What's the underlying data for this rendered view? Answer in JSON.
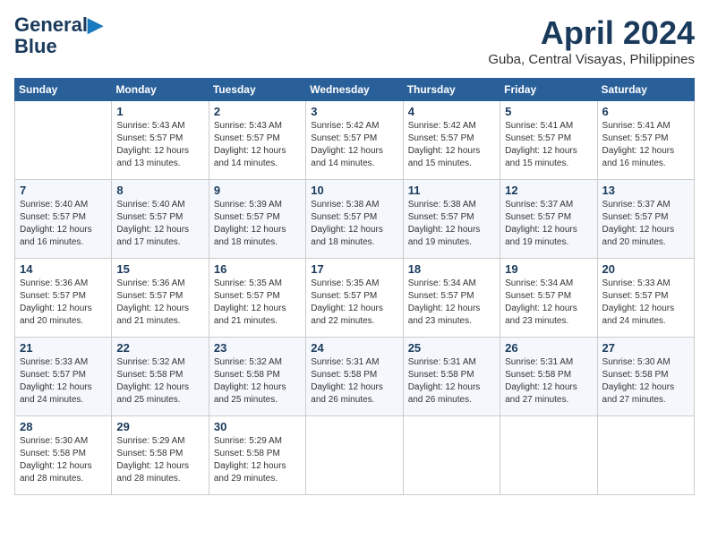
{
  "header": {
    "logo_line1": "General",
    "logo_line2": "Blue",
    "month_year": "April 2024",
    "location": "Guba, Central Visayas, Philippines"
  },
  "weekdays": [
    "Sunday",
    "Monday",
    "Tuesday",
    "Wednesday",
    "Thursday",
    "Friday",
    "Saturday"
  ],
  "weeks": [
    [
      {
        "day": "",
        "info": ""
      },
      {
        "day": "1",
        "info": "Sunrise: 5:43 AM\nSunset: 5:57 PM\nDaylight: 12 hours\nand 13 minutes."
      },
      {
        "day": "2",
        "info": "Sunrise: 5:43 AM\nSunset: 5:57 PM\nDaylight: 12 hours\nand 14 minutes."
      },
      {
        "day": "3",
        "info": "Sunrise: 5:42 AM\nSunset: 5:57 PM\nDaylight: 12 hours\nand 14 minutes."
      },
      {
        "day": "4",
        "info": "Sunrise: 5:42 AM\nSunset: 5:57 PM\nDaylight: 12 hours\nand 15 minutes."
      },
      {
        "day": "5",
        "info": "Sunrise: 5:41 AM\nSunset: 5:57 PM\nDaylight: 12 hours\nand 15 minutes."
      },
      {
        "day": "6",
        "info": "Sunrise: 5:41 AM\nSunset: 5:57 PM\nDaylight: 12 hours\nand 16 minutes."
      }
    ],
    [
      {
        "day": "7",
        "info": "Sunrise: 5:40 AM\nSunset: 5:57 PM\nDaylight: 12 hours\nand 16 minutes."
      },
      {
        "day": "8",
        "info": "Sunrise: 5:40 AM\nSunset: 5:57 PM\nDaylight: 12 hours\nand 17 minutes."
      },
      {
        "day": "9",
        "info": "Sunrise: 5:39 AM\nSunset: 5:57 PM\nDaylight: 12 hours\nand 18 minutes."
      },
      {
        "day": "10",
        "info": "Sunrise: 5:38 AM\nSunset: 5:57 PM\nDaylight: 12 hours\nand 18 minutes."
      },
      {
        "day": "11",
        "info": "Sunrise: 5:38 AM\nSunset: 5:57 PM\nDaylight: 12 hours\nand 19 minutes."
      },
      {
        "day": "12",
        "info": "Sunrise: 5:37 AM\nSunset: 5:57 PM\nDaylight: 12 hours\nand 19 minutes."
      },
      {
        "day": "13",
        "info": "Sunrise: 5:37 AM\nSunset: 5:57 PM\nDaylight: 12 hours\nand 20 minutes."
      }
    ],
    [
      {
        "day": "14",
        "info": "Sunrise: 5:36 AM\nSunset: 5:57 PM\nDaylight: 12 hours\nand 20 minutes."
      },
      {
        "day": "15",
        "info": "Sunrise: 5:36 AM\nSunset: 5:57 PM\nDaylight: 12 hours\nand 21 minutes."
      },
      {
        "day": "16",
        "info": "Sunrise: 5:35 AM\nSunset: 5:57 PM\nDaylight: 12 hours\nand 21 minutes."
      },
      {
        "day": "17",
        "info": "Sunrise: 5:35 AM\nSunset: 5:57 PM\nDaylight: 12 hours\nand 22 minutes."
      },
      {
        "day": "18",
        "info": "Sunrise: 5:34 AM\nSunset: 5:57 PM\nDaylight: 12 hours\nand 23 minutes."
      },
      {
        "day": "19",
        "info": "Sunrise: 5:34 AM\nSunset: 5:57 PM\nDaylight: 12 hours\nand 23 minutes."
      },
      {
        "day": "20",
        "info": "Sunrise: 5:33 AM\nSunset: 5:57 PM\nDaylight: 12 hours\nand 24 minutes."
      }
    ],
    [
      {
        "day": "21",
        "info": "Sunrise: 5:33 AM\nSunset: 5:57 PM\nDaylight: 12 hours\nand 24 minutes."
      },
      {
        "day": "22",
        "info": "Sunrise: 5:32 AM\nSunset: 5:58 PM\nDaylight: 12 hours\nand 25 minutes."
      },
      {
        "day": "23",
        "info": "Sunrise: 5:32 AM\nSunset: 5:58 PM\nDaylight: 12 hours\nand 25 minutes."
      },
      {
        "day": "24",
        "info": "Sunrise: 5:31 AM\nSunset: 5:58 PM\nDaylight: 12 hours\nand 26 minutes."
      },
      {
        "day": "25",
        "info": "Sunrise: 5:31 AM\nSunset: 5:58 PM\nDaylight: 12 hours\nand 26 minutes."
      },
      {
        "day": "26",
        "info": "Sunrise: 5:31 AM\nSunset: 5:58 PM\nDaylight: 12 hours\nand 27 minutes."
      },
      {
        "day": "27",
        "info": "Sunrise: 5:30 AM\nSunset: 5:58 PM\nDaylight: 12 hours\nand 27 minutes."
      }
    ],
    [
      {
        "day": "28",
        "info": "Sunrise: 5:30 AM\nSunset: 5:58 PM\nDaylight: 12 hours\nand 28 minutes."
      },
      {
        "day": "29",
        "info": "Sunrise: 5:29 AM\nSunset: 5:58 PM\nDaylight: 12 hours\nand 28 minutes."
      },
      {
        "day": "30",
        "info": "Sunrise: 5:29 AM\nSunset: 5:58 PM\nDaylight: 12 hours\nand 29 minutes."
      },
      {
        "day": "",
        "info": ""
      },
      {
        "day": "",
        "info": ""
      },
      {
        "day": "",
        "info": ""
      },
      {
        "day": "",
        "info": ""
      }
    ]
  ]
}
